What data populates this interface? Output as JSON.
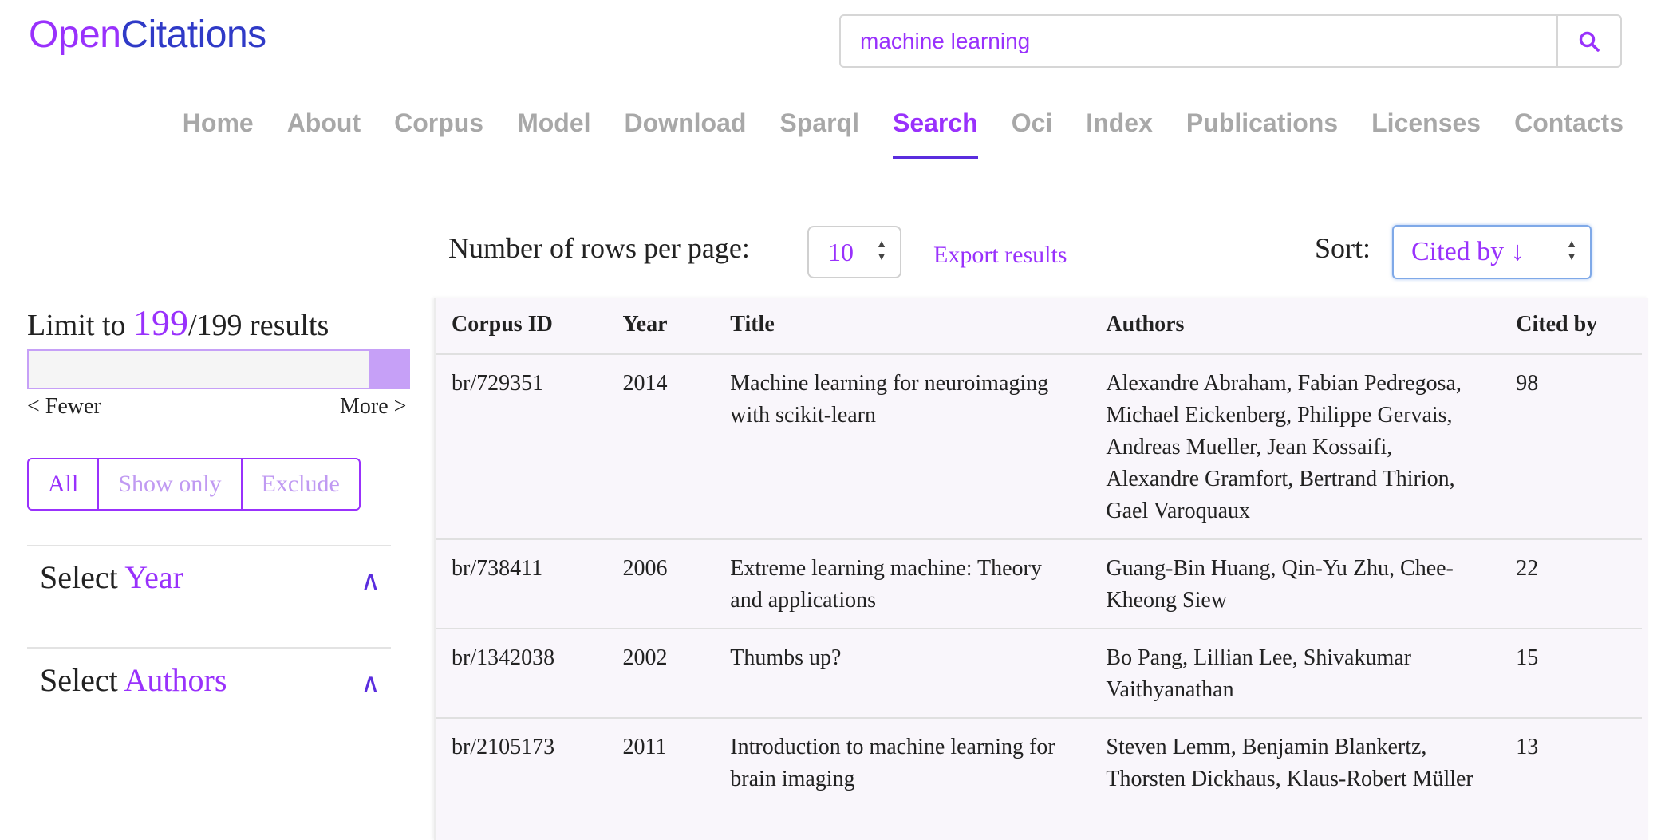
{
  "header": {
    "logo_part1": "Open",
    "logo_part2": "Citations",
    "search_value": "machine learning",
    "search_icon": "search-icon"
  },
  "nav": {
    "items": [
      "Home",
      "About",
      "Corpus",
      "Model",
      "Download",
      "Sparql",
      "Search",
      "Oci",
      "Index",
      "Publications",
      "Licenses",
      "Contacts"
    ],
    "active": "Search"
  },
  "controls": {
    "rows_label": "Number of rows per page:",
    "rows_value": "10",
    "export_label": "Export results",
    "sort_label": "Sort:",
    "sort_value": "Cited by ↓"
  },
  "filters": {
    "limit_prefix": "Limit to",
    "limit_value": "199",
    "limit_total": "/199 results",
    "slider_fraction": 1.0,
    "fewer_label": "< Fewer",
    "more_label": "More >",
    "mode_buttons": [
      "All",
      "Show only",
      "Exclude"
    ],
    "active_mode": "All",
    "facets": [
      {
        "prefix": "Select ",
        "field": "Year",
        "caret": "^"
      },
      {
        "prefix": "Select ",
        "field": "Authors",
        "caret": "^"
      }
    ]
  },
  "table": {
    "columns": [
      "Corpus ID",
      "Year",
      "Title",
      "Authors",
      "Cited by"
    ],
    "rows": [
      [
        "br/729351",
        "2014",
        "Machine learning for neuroimaging with scikit-learn",
        "Alexandre Abraham, Fabian Pedregosa, Michael Eickenberg, Philippe Gervais, Andreas Mueller, Jean Kossaifi, Alexandre Gramfort, Bertrand Thirion, Gael Varoquaux",
        "98"
      ],
      [
        "br/738411",
        "2006",
        "Extreme learning machine: Theory and applications",
        "Guang-Bin Huang, Qin-Yu Zhu, Chee-Kheong Siew",
        "22"
      ],
      [
        "br/1342038",
        "2002",
        "Thumbs up?",
        "Bo Pang, Lillian Lee, Shivakumar Vaithyanathan",
        "15"
      ],
      [
        "br/2105173",
        "2011",
        "Introduction to machine learning for brain imaging",
        "Steven Lemm, Benjamin Blankertz, Thorsten Dickhaus, Klaus-Robert Müller",
        "13"
      ]
    ]
  },
  "colors": {
    "accent": "#9931fc",
    "logo_blue": "#2f3ac7",
    "nav_underline": "#5a2dde"
  }
}
